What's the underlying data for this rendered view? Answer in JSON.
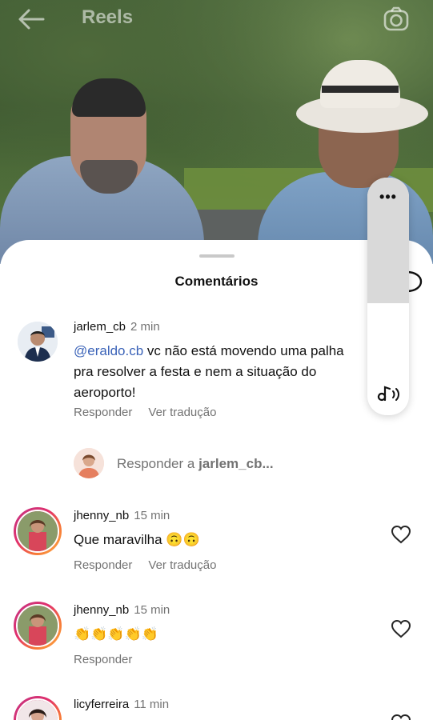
{
  "topbar": {
    "title": "Reels"
  },
  "sheet": {
    "title": "Comentários"
  },
  "comments": [
    {
      "username": "jarlem_cb",
      "time": "2 min",
      "mention": "@eraldo.cb",
      "text": " vc não está movendo uma palha pra resolver a festa e nem a situação do aeroporto!",
      "reply_label": "Responder",
      "translate_label": "Ver tradução"
    },
    {
      "username": "jhenny_nb",
      "time": "15 min",
      "text": "Que maravilha 🙃🙃",
      "reply_label": "Responder",
      "translate_label": "Ver tradução"
    },
    {
      "username": "jhenny_nb",
      "time": "15 min",
      "text": "👏👏👏👏👏",
      "reply_label": "Responder"
    },
    {
      "username": "licyferreira",
      "time": "11 min"
    }
  ],
  "reply_box": {
    "prefix": "Responder a ",
    "target": "jarlem_cb..."
  },
  "volume": {
    "dots": "•••",
    "level": 0.47
  },
  "colors": {
    "mention": "#3b63b8",
    "secondary": "#737373",
    "story_ring_start": "#c13584",
    "story_ring_end": "#fcaf45"
  }
}
